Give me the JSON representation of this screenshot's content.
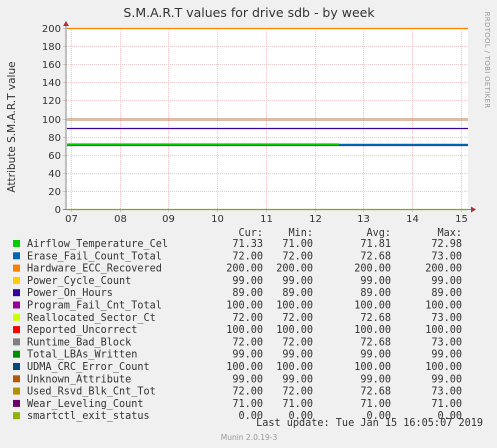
{
  "chart_data": {
    "type": "line",
    "title": "S.M.A.R.T values for drive sdb - by week",
    "ylabel": "Attribute S.M.A.R.T value",
    "side_label": "RRDTOOL / TOBI OETIKER",
    "footer": "Munin 2.0.19-3",
    "last_update": "Last update:  Tue Jan 15 16:05:07 2019",
    "ylim": [
      0,
      200
    ],
    "y_ticks": [
      "0",
      "20",
      "40",
      "60",
      "80",
      "100",
      "120",
      "140",
      "160",
      "180",
      "200"
    ],
    "y_tick_values": [
      0,
      20,
      40,
      60,
      80,
      100,
      120,
      140,
      160,
      180,
      200
    ],
    "x_ticks": [
      "07",
      "08",
      "09",
      "10",
      "11",
      "12",
      "13",
      "14",
      "15"
    ],
    "x_range": [
      6.9,
      15.15
    ],
    "grid": true,
    "columns": [
      "Cur:",
      "Min:",
      "Avg:",
      "Max:"
    ],
    "series": [
      {
        "name": "Airflow_Temperature_Cel",
        "color": "#00cc00",
        "cur": "71.33",
        "min": "71.00",
        "avg": "71.81",
        "max": "72.98",
        "value": 72,
        "end": 12.5
      },
      {
        "name": "Erase_Fail_Count_Total",
        "color": "#0066b3",
        "cur": "72.00",
        "min": "72.00",
        "avg": "72.68",
        "max": "73.00",
        "value": 72
      },
      {
        "name": "Hardware_ECC_Recovered",
        "color": "#ff8000",
        "cur": "200.00",
        "min": "200.00",
        "avg": "200.00",
        "max": "200.00",
        "value": 200
      },
      {
        "name": "Power_Cycle_Count",
        "color": "#ffcc00",
        "cur": "99.00",
        "min": "99.00",
        "avg": "99.00",
        "max": "99.00",
        "value": 99
      },
      {
        "name": "Power_On_Hours",
        "color": "#330099",
        "cur": "89.00",
        "min": "89.00",
        "avg": "89.00",
        "max": "89.00",
        "value": 89
      },
      {
        "name": "Program_Fail_Cnt_Total",
        "color": "#990099",
        "cur": "100.00",
        "min": "100.00",
        "avg": "100.00",
        "max": "100.00",
        "value": 100
      },
      {
        "name": "Reallocated_Sector_Ct",
        "color": "#ccff00",
        "cur": "72.00",
        "min": "72.00",
        "avg": "72.68",
        "max": "73.00",
        "value": 72
      },
      {
        "name": "Reported_Uncorrect",
        "color": "#ff0000",
        "cur": "100.00",
        "min": "100.00",
        "avg": "100.00",
        "max": "100.00",
        "value": 100
      },
      {
        "name": "Runtime_Bad_Block",
        "color": "#808080",
        "cur": "72.00",
        "min": "72.00",
        "avg": "72.68",
        "max": "73.00",
        "value": 72
      },
      {
        "name": "Total_LBAs_Written",
        "color": "#008f00",
        "cur": "99.00",
        "min": "99.00",
        "avg": "99.00",
        "max": "99.00",
        "value": 99
      },
      {
        "name": "UDMA_CRC_Error_Count",
        "color": "#00487d",
        "cur": "100.00",
        "min": "100.00",
        "avg": "100.00",
        "max": "100.00",
        "value": 100
      },
      {
        "name": "Unknown_Attribute",
        "color": "#b35a00",
        "cur": "99.00",
        "min": "99.00",
        "avg": "99.00",
        "max": "99.00",
        "value": 99
      },
      {
        "name": "Used_Rsvd_Blk_Cnt_Tot",
        "color": "#b38f00",
        "cur": "72.00",
        "min": "72.00",
        "avg": "72.68",
        "max": "73.00",
        "value": 72
      },
      {
        "name": "Wear_Leveling_Count",
        "color": "#6b006b",
        "cur": "71.00",
        "min": "71.00",
        "avg": "71.00",
        "max": "71.00",
        "value": 71
      },
      {
        "name": "smartctl_exit_status",
        "color": "#8fb300",
        "cur": "0.00",
        "min": "0.00",
        "avg": "0.00",
        "max": "0.00",
        "value": 0
      }
    ]
  }
}
